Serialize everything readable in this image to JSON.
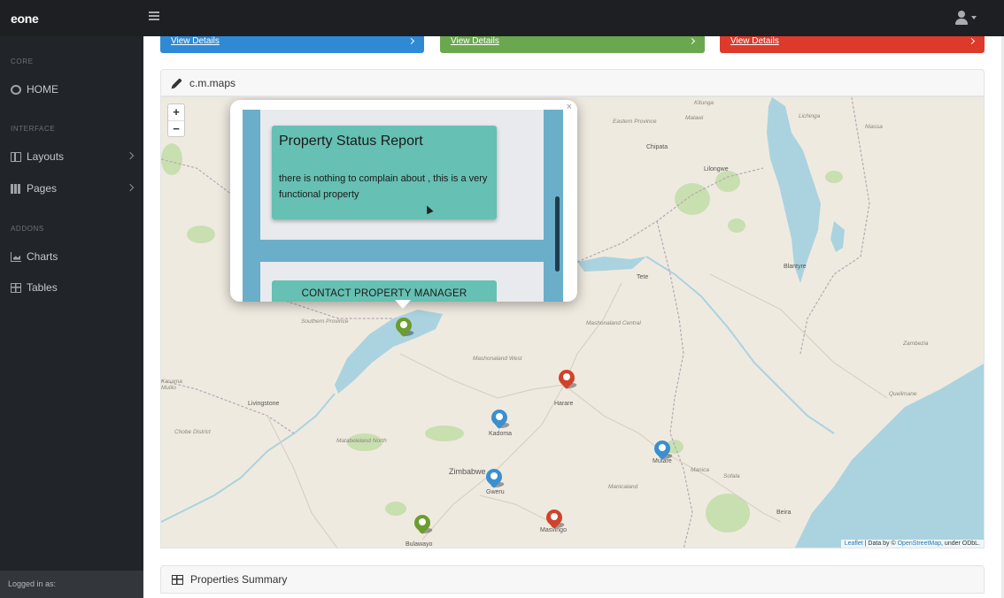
{
  "navbar": {
    "brand": "eone"
  },
  "sidebar": {
    "headings": [
      "CORE",
      "INTERFACE",
      "ADDONS"
    ],
    "items": [
      {
        "label": "HOME",
        "icon": "dashboard-icon"
      },
      {
        "label": "Layouts",
        "icon": "columns-icon"
      },
      {
        "label": "Pages",
        "icon": "book-icon"
      },
      {
        "label": "Charts",
        "icon": "area-chart-icon"
      },
      {
        "label": "Tables",
        "icon": "table-icon"
      }
    ],
    "footer": "Logged in as:"
  },
  "cards": [
    {
      "label": "View Details",
      "color": "#2f8ad6"
    },
    {
      "label": "View Details",
      "color": "#6aa84f"
    },
    {
      "label": "View Details",
      "color": "#dd3a2b"
    }
  ],
  "map_section": {
    "title": "c.m.maps",
    "zoom_in": "+",
    "zoom_out": "−",
    "attribution_lib": "Leaflet",
    "attribution_text": " | Data by © ",
    "attribution_osm": "OpenStreetMap",
    "attribution_tail": ", under ODbL.",
    "labels": {
      "malawi": "Malawi",
      "lilongwe": "Lilongwe",
      "blantyre": "Blantyre",
      "chipata": "Chipata",
      "tete": "Tete",
      "harare": "Harare",
      "kadoma": "Kadoma",
      "mutare": "Mutare",
      "gweru": "Gweru",
      "masvingo": "Masvingo",
      "bulawayo": "Bulawayo",
      "zimbabwe": "Zimbabwe",
      "beira": "Beira",
      "southern_province": "Southern Province",
      "mashonaland_west": "Mashonaland West",
      "mashonaland_central": "Mashonaland Central",
      "matabeleland_north": "Matabeleland North",
      "manicaland": "Manicaland",
      "sofala": "Sofala",
      "manica": "Manica",
      "zambezia": "Zambezia",
      "quelimane": "Quelimane",
      "eastern_province": "Eastern Province",
      "chobe": "Chobe District",
      "kasama": "Kasama Mulilo",
      "livingstone": "Livingstone",
      "kitunga": "Kitunga",
      "lichinga": "Lichinga",
      "niassa": "Niassa"
    },
    "marker_colors": {
      "blue": "#3a8fd0",
      "green": "#6c9c2e",
      "red": "#d0432a"
    }
  },
  "popup": {
    "close": "×",
    "report_title": "Property Status Report",
    "report_body": "there is nothing to complain about , this is a very functional property",
    "contact_button": "CONTACT PROPERTY MANAGER"
  },
  "summary": {
    "title": "Properties Summary"
  }
}
